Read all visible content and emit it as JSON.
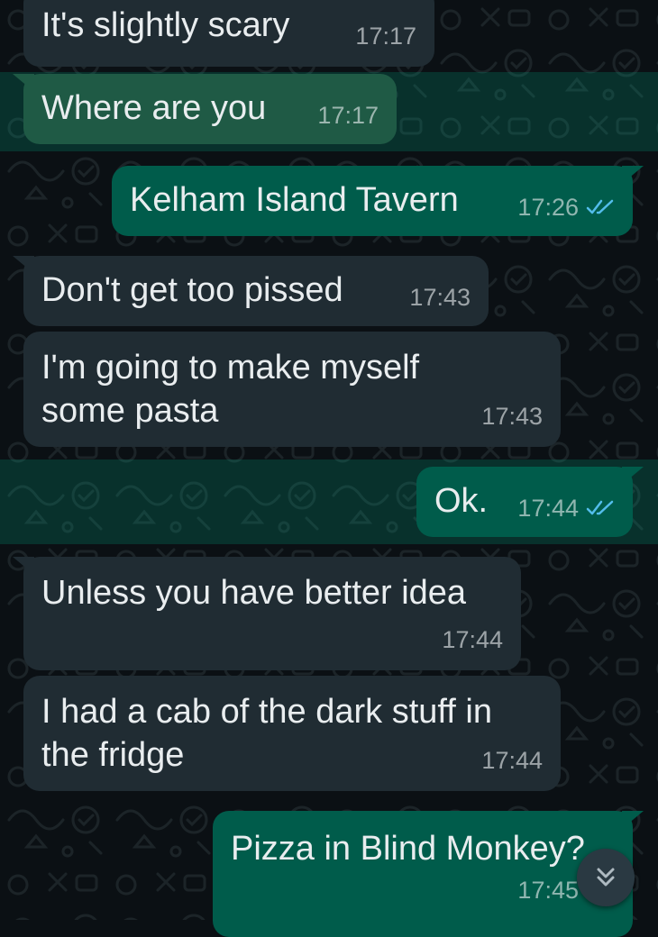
{
  "messages": [
    {
      "direction": "incoming",
      "text": "It's slightly scary",
      "time": "17:17",
      "highlighted": false
    },
    {
      "direction": "incoming",
      "text": "Where are you",
      "time": "17:17",
      "highlighted": true
    },
    {
      "direction": "outgoing",
      "text": "Kelham Island Tavern",
      "time": "17:26",
      "status": "read"
    },
    {
      "direction": "incoming",
      "text": "Don't get too pissed",
      "time": "17:43",
      "highlighted": false
    },
    {
      "direction": "incoming",
      "text": "I'm going to make myself\nsome pasta",
      "time": "17:43",
      "highlighted": false
    },
    {
      "direction": "outgoing",
      "text": "Ok.",
      "time": "17:44",
      "status": "read",
      "highlighted": true
    },
    {
      "direction": "incoming",
      "text": "Unless you have better idea",
      "time": "17:44",
      "highlighted": false
    },
    {
      "direction": "incoming",
      "text": "I had a cab of the dark stuff in\nthe fridge",
      "time": "17:44",
      "highlighted": false
    },
    {
      "direction": "outgoing",
      "text": "Pizza in Blind Monkey?",
      "time": "17:45",
      "status": "read"
    }
  ],
  "scroll_button": {
    "icon": "chevron-double-down-icon"
  },
  "colors": {
    "background": "#0b1014",
    "incoming_bubble": "#202c33",
    "outgoing_bubble": "#005c4b",
    "highlight_band": "#00a884",
    "read_tick": "#53bdeb",
    "timestamp": "#9aa4a9"
  }
}
